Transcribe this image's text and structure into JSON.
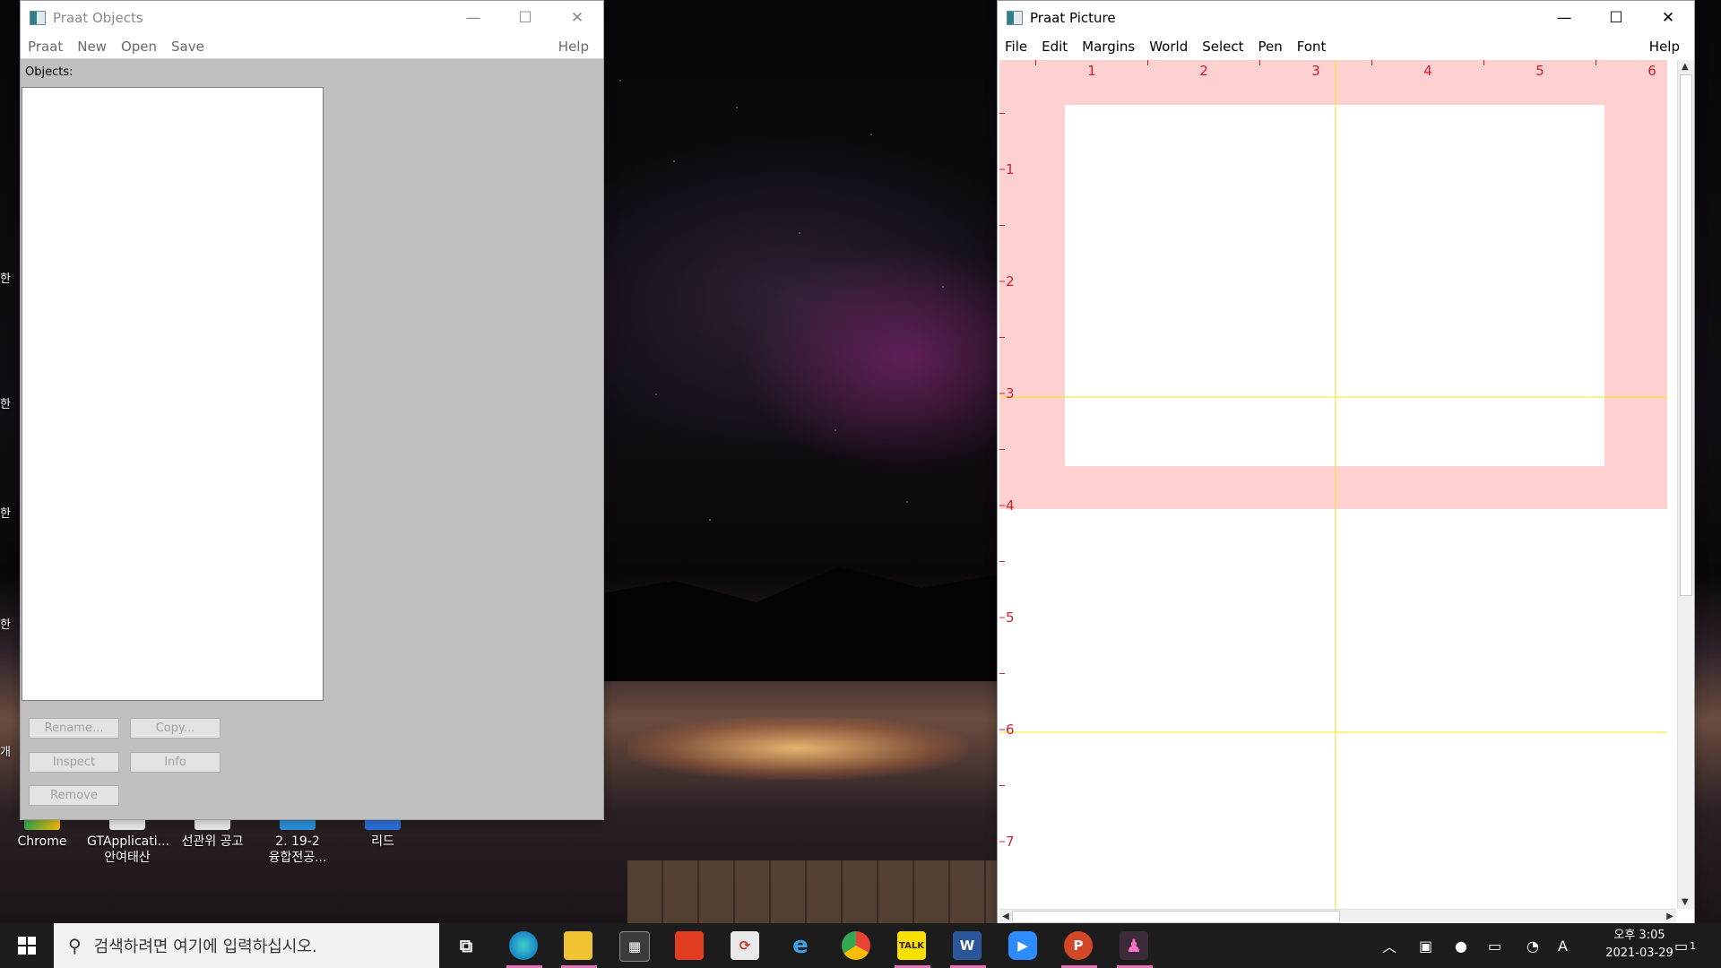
{
  "desktop": {
    "icons": [
      {
        "label": "Chrome"
      },
      {
        "label": "GTApplicati...",
        "label2": "안여태산"
      },
      {
        "label": "선관위 공고"
      },
      {
        "label": "2. 19-2",
        "label2": "융합전공..."
      },
      {
        "label": "리드"
      }
    ],
    "left_stubs": [
      "한",
      "한",
      "한",
      "한",
      "개"
    ]
  },
  "objects_window": {
    "title": "Praat Objects",
    "controls": {
      "minimize": "—",
      "maximize": "☐",
      "close": "✕"
    },
    "menu": [
      "Praat",
      "New",
      "Open",
      "Save"
    ],
    "help": "Help",
    "list_label": "Objects:",
    "buttons": {
      "rename": "Rename...",
      "copy": "Copy...",
      "inspect": "Inspect",
      "info": "Info",
      "remove": "Remove"
    }
  },
  "picture_window": {
    "title": "Praat Picture",
    "controls": {
      "minimize": "—",
      "maximize": "☐",
      "close": "✕"
    },
    "menu": [
      "File",
      "Edit",
      "Margins",
      "World",
      "Select",
      "Pen",
      "Font"
    ],
    "help": "Help",
    "ruler_top": [
      "1",
      "2",
      "3",
      "4",
      "5",
      "6"
    ],
    "ruler_left": [
      "1",
      "2",
      "3",
      "4",
      "5",
      "6",
      "7"
    ],
    "colors": {
      "selection_pink": "#ffd0d0",
      "ruler_red": "#d0202a",
      "guide_yellow": "#f5e51a"
    }
  },
  "taskbar": {
    "search_placeholder": "검색하려면 여기에 입력하십시오.",
    "apps": [
      "task-view",
      "edge",
      "file-explorer",
      "store",
      "office",
      "sync",
      "internet-explorer",
      "chrome",
      "kakaotalk",
      "word",
      "zoom",
      "powerpoint",
      "praat"
    ],
    "kakao_label": "TALK",
    "word_label": "W",
    "ppt_label": "P",
    "ime": "A",
    "clock_time": "오후 3:05",
    "clock_date": "2021-03-29",
    "notification_count": "1"
  }
}
